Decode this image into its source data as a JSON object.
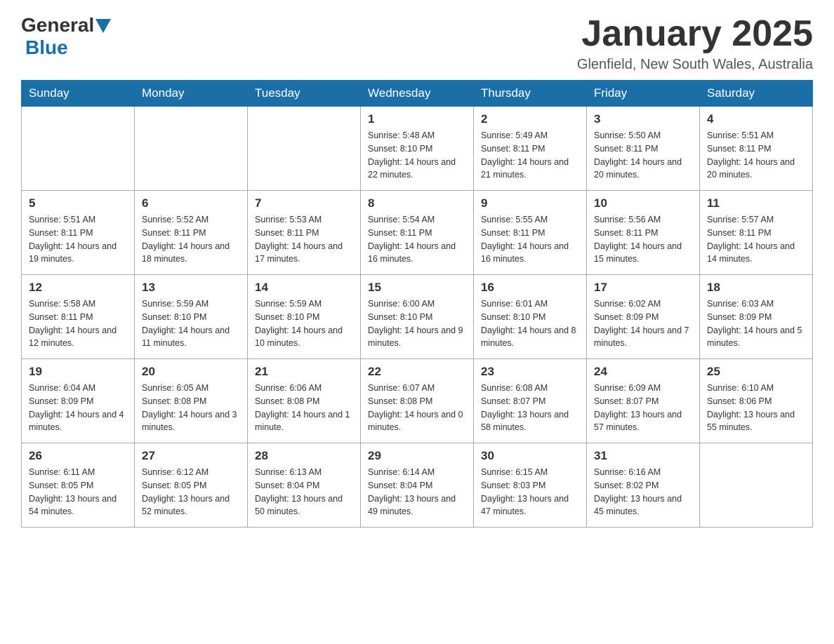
{
  "header": {
    "logo": {
      "text1": "General",
      "text2": "Blue"
    },
    "title": "January 2025",
    "subtitle": "Glenfield, New South Wales, Australia"
  },
  "days_of_week": [
    "Sunday",
    "Monday",
    "Tuesday",
    "Wednesday",
    "Thursday",
    "Friday",
    "Saturday"
  ],
  "weeks": [
    {
      "days": [
        {
          "number": "",
          "info": ""
        },
        {
          "number": "",
          "info": ""
        },
        {
          "number": "",
          "info": ""
        },
        {
          "number": "1",
          "info": "Sunrise: 5:48 AM\nSunset: 8:10 PM\nDaylight: 14 hours\nand 22 minutes."
        },
        {
          "number": "2",
          "info": "Sunrise: 5:49 AM\nSunset: 8:11 PM\nDaylight: 14 hours\nand 21 minutes."
        },
        {
          "number": "3",
          "info": "Sunrise: 5:50 AM\nSunset: 8:11 PM\nDaylight: 14 hours\nand 20 minutes."
        },
        {
          "number": "4",
          "info": "Sunrise: 5:51 AM\nSunset: 8:11 PM\nDaylight: 14 hours\nand 20 minutes."
        }
      ]
    },
    {
      "days": [
        {
          "number": "5",
          "info": "Sunrise: 5:51 AM\nSunset: 8:11 PM\nDaylight: 14 hours\nand 19 minutes."
        },
        {
          "number": "6",
          "info": "Sunrise: 5:52 AM\nSunset: 8:11 PM\nDaylight: 14 hours\nand 18 minutes."
        },
        {
          "number": "7",
          "info": "Sunrise: 5:53 AM\nSunset: 8:11 PM\nDaylight: 14 hours\nand 17 minutes."
        },
        {
          "number": "8",
          "info": "Sunrise: 5:54 AM\nSunset: 8:11 PM\nDaylight: 14 hours\nand 16 minutes."
        },
        {
          "number": "9",
          "info": "Sunrise: 5:55 AM\nSunset: 8:11 PM\nDaylight: 14 hours\nand 16 minutes."
        },
        {
          "number": "10",
          "info": "Sunrise: 5:56 AM\nSunset: 8:11 PM\nDaylight: 14 hours\nand 15 minutes."
        },
        {
          "number": "11",
          "info": "Sunrise: 5:57 AM\nSunset: 8:11 PM\nDaylight: 14 hours\nand 14 minutes."
        }
      ]
    },
    {
      "days": [
        {
          "number": "12",
          "info": "Sunrise: 5:58 AM\nSunset: 8:11 PM\nDaylight: 14 hours\nand 12 minutes."
        },
        {
          "number": "13",
          "info": "Sunrise: 5:59 AM\nSunset: 8:10 PM\nDaylight: 14 hours\nand 11 minutes."
        },
        {
          "number": "14",
          "info": "Sunrise: 5:59 AM\nSunset: 8:10 PM\nDaylight: 14 hours\nand 10 minutes."
        },
        {
          "number": "15",
          "info": "Sunrise: 6:00 AM\nSunset: 8:10 PM\nDaylight: 14 hours\nand 9 minutes."
        },
        {
          "number": "16",
          "info": "Sunrise: 6:01 AM\nSunset: 8:10 PM\nDaylight: 14 hours\nand 8 minutes."
        },
        {
          "number": "17",
          "info": "Sunrise: 6:02 AM\nSunset: 8:09 PM\nDaylight: 14 hours\nand 7 minutes."
        },
        {
          "number": "18",
          "info": "Sunrise: 6:03 AM\nSunset: 8:09 PM\nDaylight: 14 hours\nand 5 minutes."
        }
      ]
    },
    {
      "days": [
        {
          "number": "19",
          "info": "Sunrise: 6:04 AM\nSunset: 8:09 PM\nDaylight: 14 hours\nand 4 minutes."
        },
        {
          "number": "20",
          "info": "Sunrise: 6:05 AM\nSunset: 8:08 PM\nDaylight: 14 hours\nand 3 minutes."
        },
        {
          "number": "21",
          "info": "Sunrise: 6:06 AM\nSunset: 8:08 PM\nDaylight: 14 hours\nand 1 minute."
        },
        {
          "number": "22",
          "info": "Sunrise: 6:07 AM\nSunset: 8:08 PM\nDaylight: 14 hours\nand 0 minutes."
        },
        {
          "number": "23",
          "info": "Sunrise: 6:08 AM\nSunset: 8:07 PM\nDaylight: 13 hours\nand 58 minutes."
        },
        {
          "number": "24",
          "info": "Sunrise: 6:09 AM\nSunset: 8:07 PM\nDaylight: 13 hours\nand 57 minutes."
        },
        {
          "number": "25",
          "info": "Sunrise: 6:10 AM\nSunset: 8:06 PM\nDaylight: 13 hours\nand 55 minutes."
        }
      ]
    },
    {
      "days": [
        {
          "number": "26",
          "info": "Sunrise: 6:11 AM\nSunset: 8:05 PM\nDaylight: 13 hours\nand 54 minutes."
        },
        {
          "number": "27",
          "info": "Sunrise: 6:12 AM\nSunset: 8:05 PM\nDaylight: 13 hours\nand 52 minutes."
        },
        {
          "number": "28",
          "info": "Sunrise: 6:13 AM\nSunset: 8:04 PM\nDaylight: 13 hours\nand 50 minutes."
        },
        {
          "number": "29",
          "info": "Sunrise: 6:14 AM\nSunset: 8:04 PM\nDaylight: 13 hours\nand 49 minutes."
        },
        {
          "number": "30",
          "info": "Sunrise: 6:15 AM\nSunset: 8:03 PM\nDaylight: 13 hours\nand 47 minutes."
        },
        {
          "number": "31",
          "info": "Sunrise: 6:16 AM\nSunset: 8:02 PM\nDaylight: 13 hours\nand 45 minutes."
        },
        {
          "number": "",
          "info": ""
        }
      ]
    }
  ]
}
